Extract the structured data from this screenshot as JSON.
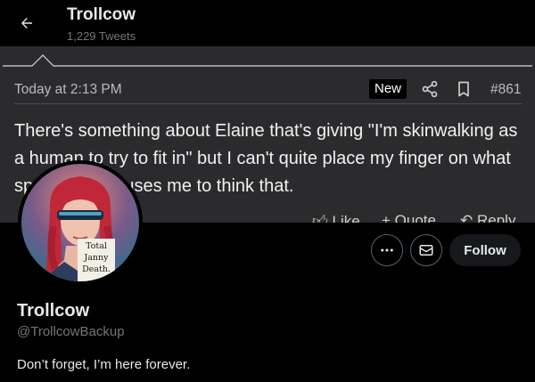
{
  "header": {
    "title": "Trollcow",
    "tweet_count": "1,229 Tweets",
    "back_icon": "arrow-left-icon"
  },
  "banner": {
    "timestamp": "Today at 2:13 PM",
    "badge": "New",
    "post_number": "#861",
    "text": "There's something about Elaine that's giving \"I'm skinwalking as a human to try to fit in\" but I can't quite place my finger on what specifically causes me to think that.",
    "actions": [
      "Like",
      "+ Quote",
      "Reply"
    ],
    "colors": {
      "background": "#2b2b2d",
      "text": "#f1f1f1",
      "meta": "#b9bbbe"
    }
  },
  "avatar": {
    "note_lines": [
      "Total",
      "Janny",
      "Death."
    ],
    "hair_color": "#c0283a",
    "background_color": "#2a6f8f"
  },
  "profile_actions": {
    "more_icon": "more-horizontal-icon",
    "message_icon": "envelope-icon",
    "follow_label": "Follow"
  },
  "profile": {
    "name": "Trollcow",
    "handle": "@TrollcowBackup",
    "bio": "Don’t forget, I’m here forever."
  },
  "colors": {
    "page_background": "#000000",
    "primary_text": "#e7e9ea",
    "secondary_text": "#71767b",
    "border": "#536471"
  }
}
